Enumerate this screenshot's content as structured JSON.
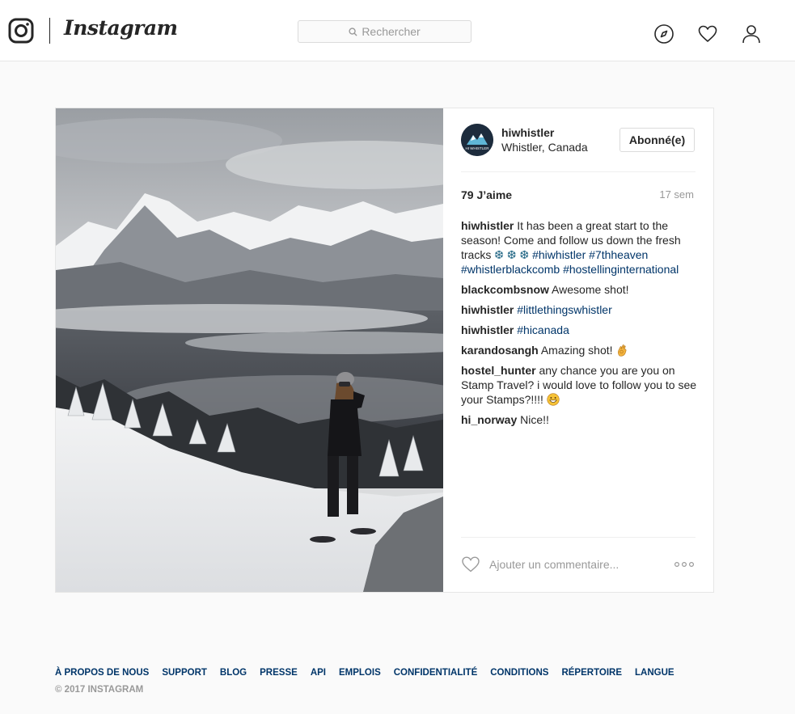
{
  "header": {
    "wordmark": "Instagram",
    "search_placeholder": "Rechercher"
  },
  "post": {
    "username": "hiwhistler",
    "avatar_text": "HI WHISTLER",
    "location": "Whistler, Canada",
    "follow_label": "Abonné(e)",
    "likes": "79 J’aime",
    "age": "17 sem",
    "caption": {
      "author": "hiwhistler",
      "text": "It has been a great start to the season! Come and follow us down the fresh tracks",
      "tags": [
        "#hiwhistler",
        "#7thheaven",
        "#whistlerblackcomb",
        "#hostellinginternational"
      ]
    },
    "comments": [
      {
        "author": "blackcombsnow",
        "text": "Awesome shot!"
      },
      {
        "author": "hiwhistler",
        "text": "#littlethingswhistler"
      },
      {
        "author": "hiwhistler",
        "text": "#hicanada"
      },
      {
        "author": "karandosangh",
        "text": "Amazing shot!"
      },
      {
        "author": "hostel_hunter",
        "text": "any chance you are you on Stamp Travel? i would love to follow you to see your Stamps?!!!!"
      },
      {
        "author": "hi_norway",
        "text": "Nice!!"
      }
    ],
    "comment_placeholder": "Ajouter un commentaire..."
  },
  "footer": {
    "links": [
      "À PROPOS DE NOUS",
      "SUPPORT",
      "BLOG",
      "PRESSE",
      "API",
      "EMPLOIS",
      "CONFIDENTIALITÉ",
      "CONDITIONS",
      "RÉPERTOIRE",
      "LANGUE"
    ],
    "copyright": "© 2017 INSTAGRAM"
  },
  "colors": {
    "link": "#003569",
    "muted": "#999999",
    "border": "#e6e6e6"
  }
}
